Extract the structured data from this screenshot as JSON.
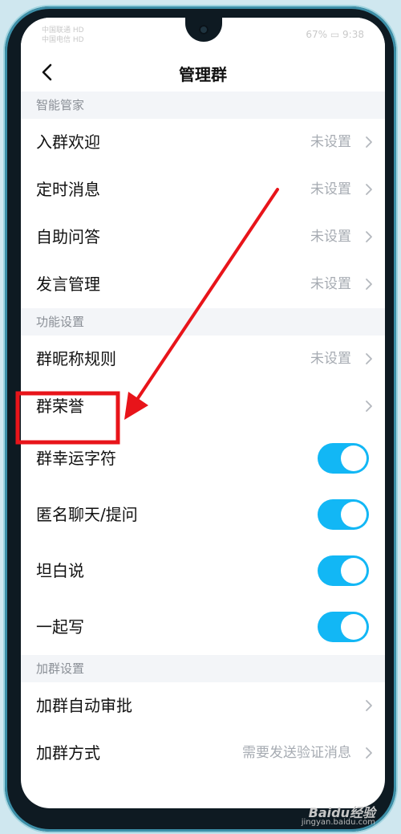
{
  "status_bar": {
    "carrier_line1": "中国联通 HD",
    "carrier_line2": "中国电信 HD",
    "battery": "67%",
    "time": "9:38"
  },
  "header": {
    "title": "管理群"
  },
  "sections": {
    "smart": {
      "title": "智能管家",
      "items": [
        {
          "label": "入群欢迎",
          "value": "未设置"
        },
        {
          "label": "定时消息",
          "value": "未设置"
        },
        {
          "label": "自助问答",
          "value": "未设置"
        },
        {
          "label": "发言管理",
          "value": "未设置"
        }
      ]
    },
    "features": {
      "title": "功能设置",
      "items": [
        {
          "label": "群昵称规则",
          "value": "未设置"
        },
        {
          "label": "群荣誉",
          "value": ""
        }
      ],
      "toggles": [
        {
          "label": "群幸运字符",
          "on": true
        },
        {
          "label": "匿名聊天/提问",
          "on": true
        },
        {
          "label": "坦白说",
          "on": true
        },
        {
          "label": "一起写",
          "on": true
        }
      ]
    },
    "join": {
      "title": "加群设置",
      "items": [
        {
          "label": "加群自动审批",
          "value": ""
        },
        {
          "label": "加群方式",
          "value": "需要发送验证消息"
        }
      ]
    }
  },
  "colors": {
    "toggle_on": "#12b7f5",
    "annotation": "#e8141a"
  },
  "watermark": {
    "brand": "Baidu经验",
    "url": "jingyan.baidu.com"
  }
}
